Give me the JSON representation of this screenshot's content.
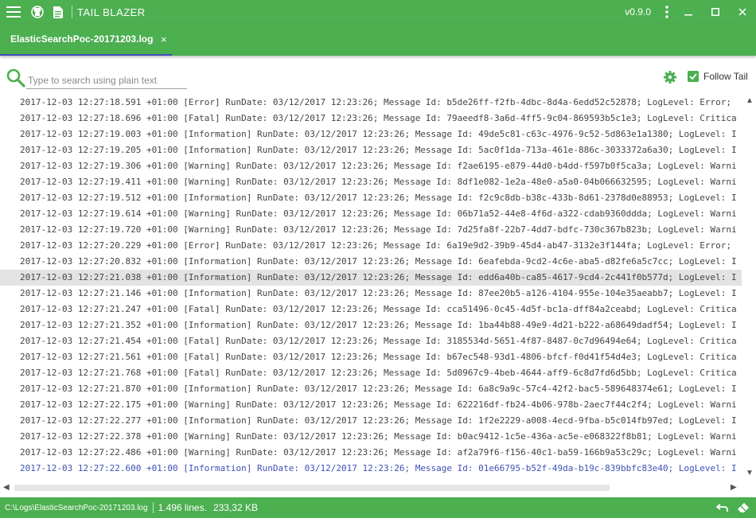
{
  "window": {
    "title": "TAIL BLAZER",
    "version": "v0.9.0",
    "icons": [
      "menu-icon",
      "github-icon",
      "document-icon",
      "more-vert-icon",
      "minimize-icon",
      "maximize-icon",
      "close-icon"
    ]
  },
  "tab": {
    "label": "ElasticSearchPoc-20171203.log",
    "close": "×"
  },
  "toolbar": {
    "search_placeholder": "Type to search using plain text",
    "search_value": "",
    "follow_tail_label": "Follow Tail",
    "follow_tail_checked": true
  },
  "log": {
    "selected_index": 11,
    "tail_index": 23,
    "lines": [
      "2017-12-03 12:27:18.591 +01:00 [Error] RunDate: 03/12/2017 12:23:26; Message Id: b5de26ff-f2fb-4dbc-8d4a-6edd52c52878; LogLevel: Error;",
      "2017-12-03 12:27:18.696 +01:00 [Fatal] RunDate: 03/12/2017 12:23:26; Message Id: 79aeedf8-3a6d-4ff5-9c04-869593b5c1e3; LogLevel: Critica",
      "2017-12-03 12:27:19.003 +01:00 [Information] RunDate: 03/12/2017 12:23:26; Message Id: 49de5c81-c63c-4976-9c52-5d863e1a1380; LogLevel: I",
      "2017-12-03 12:27:19.205 +01:00 [Information] RunDate: 03/12/2017 12:23:26; Message Id: 5ac0f1da-713a-461e-886c-3033372a6a30; LogLevel: I",
      "2017-12-03 12:27:19.306 +01:00 [Warning] RunDate: 03/12/2017 12:23:26; Message Id: f2ae6195-e879-44d0-b4dd-f597b0f5ca3a; LogLevel: Warni",
      "2017-12-03 12:27:19.411 +01:00 [Warning] RunDate: 03/12/2017 12:23:26; Message Id: 8df1e082-1e2a-48e0-a5a0-04b066632595; LogLevel: Warni",
      "2017-12-03 12:27:19.512 +01:00 [Information] RunDate: 03/12/2017 12:23:26; Message Id: f2c9c8db-b38c-433b-8d61-2378d0e88953; LogLevel: I",
      "2017-12-03 12:27:19.614 +01:00 [Warning] RunDate: 03/12/2017 12:23:26; Message Id: 06b71a52-44e8-4f6d-a322-cdab9360ddda; LogLevel: Warni",
      "2017-12-03 12:27:19.720 +01:00 [Warning] RunDate: 03/12/2017 12:23:26; Message Id: 7d25fa8f-22b7-4dd7-bdfc-730c367b823b; LogLevel: Warni",
      "2017-12-03 12:27:20.229 +01:00 [Error] RunDate: 03/12/2017 12:23:26; Message Id: 6a19e9d2-39b9-45d4-ab47-3132e3f144fa; LogLevel: Error;",
      "2017-12-03 12:27:20.832 +01:00 [Information] RunDate: 03/12/2017 12:23:26; Message Id: 6eafebda-9cd2-4c6e-aba5-d82fe6a5c7cc; LogLevel: I",
      "2017-12-03 12:27:21.038 +01:00 [Information] RunDate: 03/12/2017 12:23:26; Message Id: edd6a40b-ca85-4617-9cd4-2c441f0b577d; LogLevel: I",
      "2017-12-03 12:27:21.146 +01:00 [Information] RunDate: 03/12/2017 12:23:26; Message Id: 87ee20b5-a126-4104-955e-104e35aeabb7; LogLevel: I",
      "2017-12-03 12:27:21.247 +01:00 [Fatal] RunDate: 03/12/2017 12:23:26; Message Id: cca51496-0c45-4d5f-bc1a-dff84a2ceabd; LogLevel: Critica",
      "2017-12-03 12:27:21.352 +01:00 [Information] RunDate: 03/12/2017 12:23:26; Message Id: 1ba44b88-49e9-4d21-b222-a68649dadf54; LogLevel: I",
      "2017-12-03 12:27:21.454 +01:00 [Fatal] RunDate: 03/12/2017 12:23:26; Message Id: 3185534d-5651-4f87-8487-0c7d96494e64; LogLevel: Critica",
      "2017-12-03 12:27:21.561 +01:00 [Fatal] RunDate: 03/12/2017 12:23:26; Message Id: b67ec548-93d1-4806-bfcf-f0d41f54d4e3; LogLevel: Critica",
      "2017-12-03 12:27:21.768 +01:00 [Fatal] RunDate: 03/12/2017 12:23:26; Message Id: 5d0967c9-4beb-4644-aff9-6c8d7fd6d5bb; LogLevel: Critica",
      "2017-12-03 12:27:21.870 +01:00 [Information] RunDate: 03/12/2017 12:23:26; Message Id: 6a8c9a9c-57c4-42f2-bac5-589648374e61; LogLevel: I",
      "2017-12-03 12:27:22.175 +01:00 [Warning] RunDate: 03/12/2017 12:23:26; Message Id: 622216df-fb24-4b06-978b-2aec7f44c2f4; LogLevel: Warni",
      "2017-12-03 12:27:22.277 +01:00 [Information] RunDate: 03/12/2017 12:23:26; Message Id: 1f2e2229-a008-4ecd-9fba-b5c014fb97ed; LogLevel: I",
      "2017-12-03 12:27:22.378 +01:00 [Warning] RunDate: 03/12/2017 12:23:26; Message Id: b0ac9412-1c5e-436a-ac5e-e068322f8b81; LogLevel: Warni",
      "2017-12-03 12:27:22.486 +01:00 [Warning] RunDate: 03/12/2017 12:23:26; Message Id: af2a79f6-f156-40c1-ba59-166b9a53c29c; LogLevel: Warni",
      "2017-12-03 12:27:22.600 +01:00 [Information] RunDate: 03/12/2017 12:23:26; Message Id: 01e66795-b52f-49da-b19c-839bbfc83e40; LogLevel: I"
    ]
  },
  "status": {
    "path": "C:\\Logs\\ElasticSearchPoc-20171203.log",
    "lines": "1.496 lines.",
    "size": "233,32 KB"
  },
  "colors": {
    "primary": "#4caf50",
    "accent": "#3f51b5",
    "selected_row": "#e3e3e3"
  }
}
